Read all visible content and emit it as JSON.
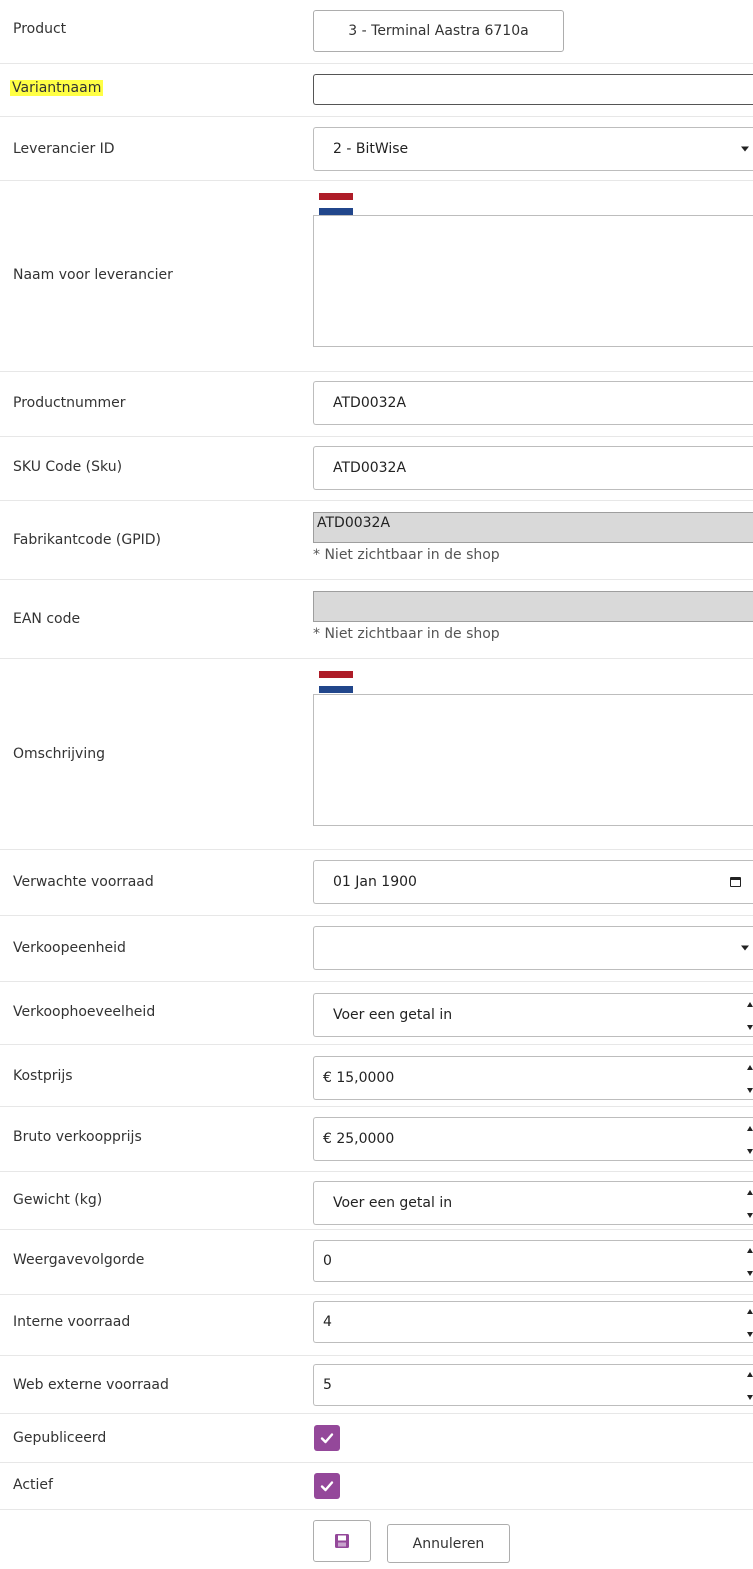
{
  "colors": {
    "accent": "#94489a",
    "highlight": "#ffff44",
    "disabled_bg": "#d9d9d9",
    "flag_red": "#ae1c28",
    "flag_white": "#ffffff",
    "flag_blue": "#21468b"
  },
  "fields": {
    "product": {
      "label": "Product",
      "value": "3 - Terminal Aastra 6710a"
    },
    "variantnaam": {
      "label": "Variantnaam",
      "value": ""
    },
    "leverancier": {
      "label": "Leverancier ID",
      "value": "2 - BitWise"
    },
    "naam_leverancier": {
      "label": "Naam voor leverancier",
      "value": ""
    },
    "productnummer": {
      "label": "Productnummer",
      "value": "ATD0032A"
    },
    "sku": {
      "label": "SKU Code (Sku)",
      "value": "ATD0032A"
    },
    "gpid": {
      "label": "Fabrikantcode (GPID)",
      "value": "ATD0032A",
      "note": "* Niet zichtbaar in de shop"
    },
    "ean": {
      "label": "EAN code",
      "value": "",
      "note": "* Niet zichtbaar in de shop"
    },
    "omschrijving": {
      "label": "Omschrijving",
      "value": ""
    },
    "verwachte_voorraad": {
      "label": "Verwachte voorraad",
      "value": "01 Jan 1900"
    },
    "verkoopeenheid": {
      "label": "Verkoopeenheid",
      "value": ""
    },
    "verkoophoeveelheid": {
      "label": "Verkoophoeveelheid",
      "placeholder": "Voer een getal in"
    },
    "kostprijs": {
      "label": "Kostprijs",
      "value": "€ 15,0000"
    },
    "bruto": {
      "label": "Bruto verkoopprijs",
      "value": "€ 25,0000"
    },
    "gewicht": {
      "label": "Gewicht (kg)",
      "placeholder": "Voer een getal in"
    },
    "weergavevolgorde": {
      "label": "Weergavevolgorde",
      "value": "0"
    },
    "interne_voorraad": {
      "label": "Interne voorraad",
      "value": "4"
    },
    "web_externe_voorraad": {
      "label": "Web externe voorraad",
      "value": "5"
    },
    "gepubliceerd": {
      "label": "Gepubliceerd",
      "checked": true
    },
    "actief": {
      "label": "Actief",
      "checked": true
    }
  },
  "actions": {
    "save_icon": "floppy-disk-icon",
    "cancel_label": "Annuleren"
  }
}
